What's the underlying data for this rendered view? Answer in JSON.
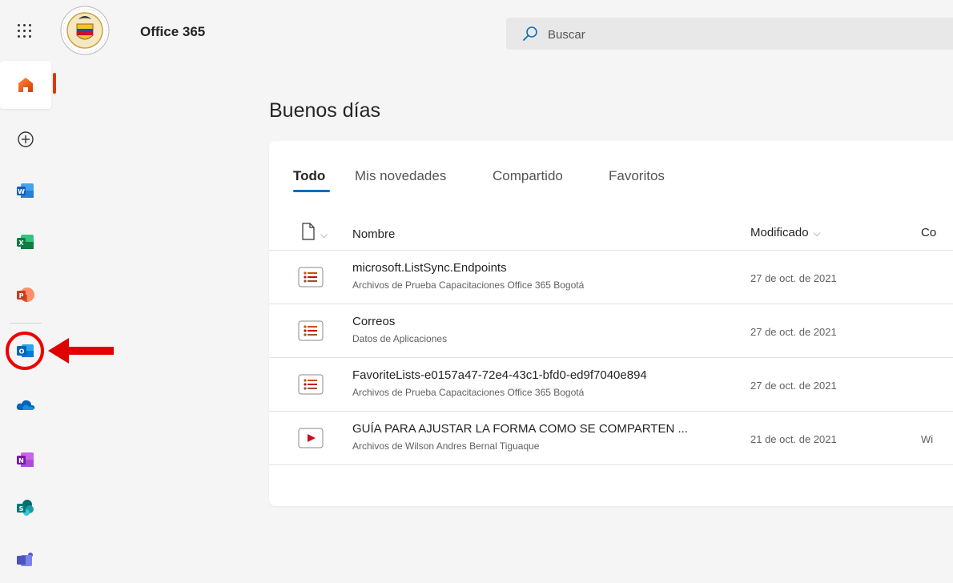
{
  "header": {
    "app_title": "Office 365",
    "search_placeholder": "Buscar"
  },
  "rail": {
    "items": [
      {
        "name": "home",
        "icon": "home-icon",
        "active": true
      },
      {
        "name": "create",
        "icon": "plus-circle-icon"
      },
      {
        "name": "word",
        "icon": "word-icon"
      },
      {
        "name": "excel",
        "icon": "excel-icon"
      },
      {
        "name": "powerpoint",
        "icon": "powerpoint-icon"
      },
      {
        "name": "outlook",
        "icon": "outlook-icon",
        "highlighted": true
      },
      {
        "name": "onedrive",
        "icon": "onedrive-icon"
      },
      {
        "name": "onenote",
        "icon": "onenote-icon"
      },
      {
        "name": "sharepoint",
        "icon": "sharepoint-icon"
      },
      {
        "name": "teams",
        "icon": "teams-icon"
      }
    ]
  },
  "main": {
    "greeting": "Buenos días",
    "tabs": [
      {
        "label": "Todo",
        "active": true
      },
      {
        "label": "Mis novedades"
      },
      {
        "label": "Compartido"
      },
      {
        "label": "Favoritos"
      }
    ],
    "columns": {
      "name": "Nombre",
      "modified": "Modificado",
      "extra": "Co"
    },
    "files": [
      {
        "name": "microsoft.ListSync.Endpoints",
        "location": "Archivos de Prueba Capacitaciones Office 365 Bogotá",
        "modified": "27 de oct. de 2021",
        "extra": "",
        "icon": "list-file-icon"
      },
      {
        "name": "Correos",
        "location": "Datos de Aplicaciones",
        "modified": "27 de oct. de 2021",
        "extra": "",
        "icon": "list-file-icon"
      },
      {
        "name": "FavoriteLists-e0157a47-72e4-43c1-bfd0-ed9f7040e894",
        "location": "Archivos de Prueba Capacitaciones Office 365 Bogotá",
        "modified": "27 de oct. de 2021",
        "extra": "",
        "icon": "list-file-icon"
      },
      {
        "name": "GUÍA PARA AJUSTAR LA FORMA COMO SE COMPARTEN ...",
        "location": "Archivos de Wilson Andres Bernal Tiguaque",
        "modified": "21 de oct. de 2021",
        "extra": "Wi",
        "icon": "video-file-icon"
      }
    ]
  },
  "colors": {
    "accent": "#0f6cbd",
    "active_bar": "#d83b01",
    "annotation": "#e00000"
  }
}
